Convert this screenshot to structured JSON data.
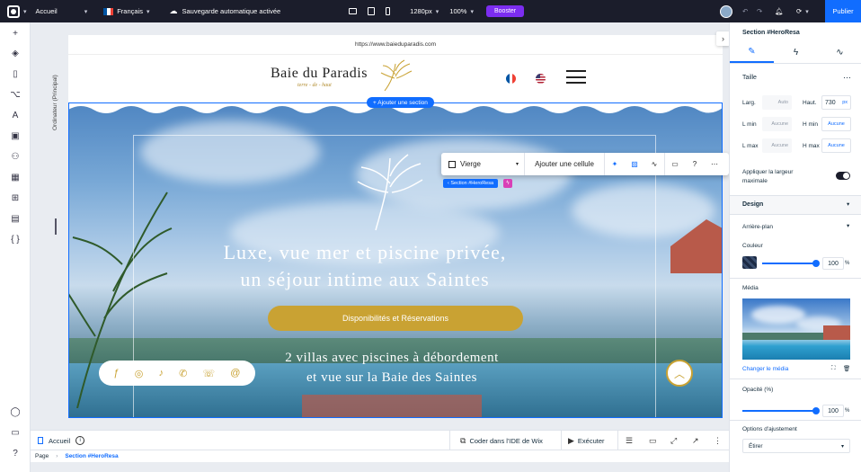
{
  "topbar": {
    "page_label": "Accueil",
    "language_label": "Français",
    "autosave_text": "Sauvegarde automatique activée",
    "width_label": "1280px",
    "zoom_label": "100%",
    "boost_label": "Booster",
    "publish_label": "Publier"
  },
  "canvas": {
    "device_label": "Ordinateur (Principal)",
    "add_section_label": "+ Ajouter une section",
    "section_badge": "‹ Section #HeroResa",
    "toolbar": {
      "layout_value": "Vierge",
      "add_cell_label": "Ajouter une cellule",
      "help_label": "?"
    }
  },
  "site": {
    "url": "https://www.baieduparadis.com",
    "logo_text": "Baie du Paradis",
    "logo_tagline": "terre - de - haut",
    "hero_heading_line1": "Luxe, vue mer et piscine privée,",
    "hero_heading_line2": "un séjour intime aux Saintes",
    "cta_label": "Disponibilités et Réservations",
    "hero_sub_line1": "2 villas avec piscines à débordement",
    "hero_sub_line2": "et vue sur la Baie des Saintes"
  },
  "right_panel": {
    "title": "Section #HeroResa",
    "size_label": "Taille",
    "width_label": "Larg.",
    "width_value": "Auto",
    "height_label": "Haut.",
    "height_value": "730",
    "height_unit": "px",
    "lmin_label": "L min",
    "lmin_value": "Aucune",
    "hmin_label": "H min",
    "hmin_value": "Aucune",
    "lmax_label": "L max",
    "lmax_value": "Aucune",
    "hmax_label": "H max",
    "hmax_value": "Aucune",
    "max_width_label_1": "Appliquer la largeur",
    "max_width_label_2": "maximale",
    "design_label": "Design",
    "background_label": "Arrière-plan",
    "color_label": "Couleur",
    "color_opacity": "100",
    "percent": "%",
    "media_label": "Média",
    "change_media_label": "Changer le média",
    "opacity_label": "Opacité (%)",
    "opacity_value": "100",
    "fit_options_label": "Options d'ajustement",
    "fit_value": "Étirer"
  },
  "bottombar": {
    "page_label": "Accueil",
    "ide_label": "Coder dans l'IDE de Wix",
    "run_label": "Exécuter"
  },
  "breadcrumb": {
    "root": "Page",
    "current": "Section #HeroResa"
  },
  "colors": {
    "accent": "#116dff",
    "gold": "#c9a233",
    "boost": "#7c2df0",
    "topbar": "#1b1d2b"
  }
}
